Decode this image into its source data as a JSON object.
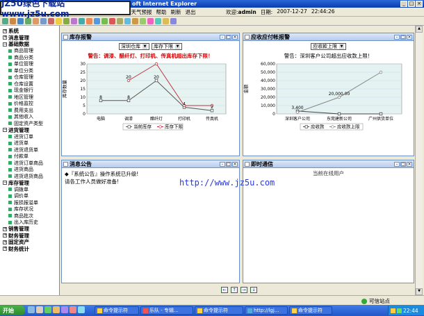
{
  "window": {
    "title": "oft Internet Explorer"
  },
  "logo": {
    "text": "JZ5U绿色下载站 www.jz5u.com"
  },
  "menu": {
    "items": [
      "天气预报",
      "帮助",
      "刷新",
      "退出"
    ],
    "prefix": "历"
  },
  "user": {
    "welcome": "欢迎:",
    "name": "admin",
    "date_label": "日期:",
    "date": "2007-12-27",
    "time": "22:44:26"
  },
  "sidebar": {
    "groups": [
      {
        "label": "系统",
        "items": []
      },
      {
        "label": "消息管理",
        "items": []
      },
      {
        "label": "基础数据",
        "items": [
          "商品管理",
          "商品分类",
          "单位管理",
          "单位分类",
          "仓库管理",
          "仓库设置",
          "现金银行",
          "地区管理",
          "价格监控",
          "费用支出",
          "其他收入",
          "固定资产类型"
        ]
      },
      {
        "label": "进货管理",
        "items": [
          "进货订单",
          "进货单",
          "进货退货单",
          "付款单",
          "进货订单商品",
          "进货商品",
          "进货退货商品"
        ]
      },
      {
        "label": "库存管理",
        "items": [
          "调拨单",
          "调价单",
          "报损报溢单",
          "库存状况",
          "商品批次",
          "出入库历史"
        ]
      },
      {
        "label": "销售管理",
        "items": []
      },
      {
        "label": "财务管理",
        "items": []
      },
      {
        "label": "固定资产",
        "items": []
      },
      {
        "label": "财务统计",
        "items": []
      }
    ]
  },
  "panels": {
    "stock": {
      "title": "库存报警",
      "warehouse": "深圳仓库",
      "limit": "库存下限",
      "warning": "警告：调漆、醋纤灯、打印机、传真机超出库存下限！"
    },
    "receivable": {
      "title": "应收应付帐报警",
      "limit": "应收款上限",
      "warning": "警告：深圳客户公司超出应收款上限！"
    },
    "notice": {
      "title": "消息公告",
      "line1": "◆『系统公告』操作系统已升级!",
      "line2": "请各工作人员做好准备!"
    },
    "im": {
      "title": "即时通信",
      "online": "当前在线用户"
    }
  },
  "watermark": "http://www.jz5u.com",
  "status": {
    "zone": "可信站点"
  },
  "taskbar": {
    "start": "开始",
    "tasks": [
      "命令提示符",
      "乐队 - 专辑...",
      "命令提示符",
      "http://lgj...",
      "命令提示符"
    ],
    "clock": "22:44"
  },
  "chart_data": [
    {
      "type": "line",
      "ylabel": "库存数量",
      "categories": [
        "电脑",
        "调漆",
        "醋纤灯",
        "打印机",
        "传真机"
      ],
      "ylim": [
        0,
        30
      ],
      "yticks": [
        0,
        5,
        10,
        15,
        20,
        25,
        30
      ],
      "series": [
        {
          "name": "当前库存",
          "values": [
            8,
            8,
            20,
            4,
            2
          ],
          "color": "#555555"
        },
        {
          "name": "库存下限",
          "values": [
            null,
            20,
            30,
            5,
            5
          ],
          "color": "#bb3344"
        }
      ],
      "labels": [
        [
          "8",
          0
        ],
        [
          "8",
          1
        ],
        [
          "20",
          1
        ],
        [
          "20",
          2
        ],
        [
          "4",
          3
        ],
        [
          "2",
          4
        ]
      ]
    },
    {
      "type": "line",
      "ylabel": "金额",
      "categories": [
        "深圳客户公司",
        "东莞建新公司",
        "广州供货单位"
      ],
      "ylim": [
        0,
        60000
      ],
      "yticks": [
        "0",
        "10,000",
        "20,000",
        "30,000",
        "40,000",
        "50,000",
        "60,000"
      ],
      "series": [
        {
          "name": "应收款",
          "values": [
            3400,
            0,
            0
          ],
          "color": "#444444"
        },
        {
          "name": "应收款上限",
          "values": [
            2000,
            20000,
            50000
          ],
          "color": "#888888"
        }
      ],
      "labels": [
        [
          "3,400",
          0
        ],
        [
          "20,000.00",
          1
        ]
      ]
    }
  ],
  "colors": {
    "accent": "#0a3cae",
    "panel_border": "#6b8fc9",
    "warning": "#dd0000"
  }
}
